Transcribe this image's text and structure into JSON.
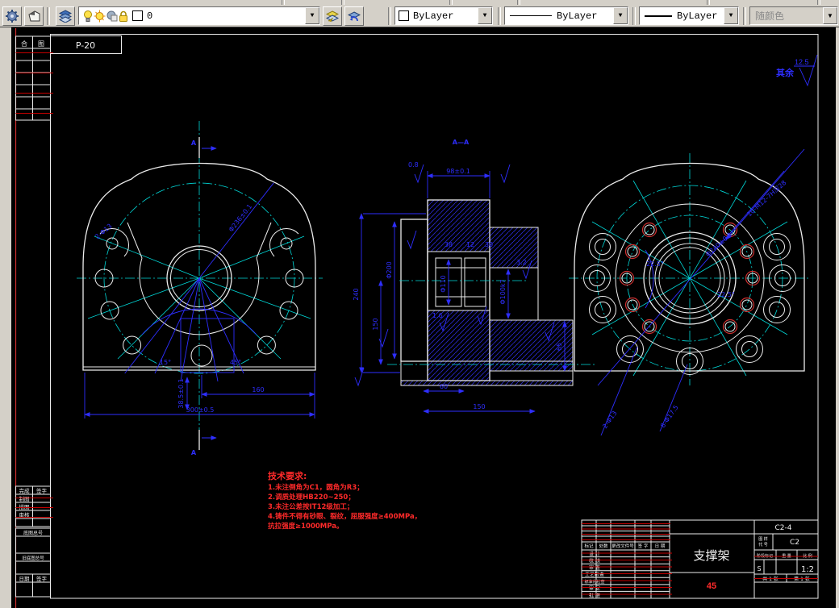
{
  "toolbar": {
    "layer_name": "0",
    "color": "ByLayer",
    "linetype": "ByLayer",
    "lineweight": "ByLayer",
    "plot_style": "随颜色"
  },
  "sheet": {
    "p20": "P-20",
    "surface_note": "其余",
    "roughness": "12.5",
    "section_letter": "A"
  },
  "left_top": {
    "h1": "合",
    "h2": "图"
  },
  "left_bottom": {
    "c1": "完成",
    "c2": "签字",
    "r1": "制图",
    "r2": "描图",
    "r3": "审核",
    "base_no": "底图总号",
    "old_no": "旧底图总号",
    "d1": "日期",
    "d2": "签字"
  },
  "front": {
    "bolt_circle": "Φ236±0.1",
    "lug_holes": "2-Φ13",
    "width": "300±0.5",
    "offset": "160",
    "height": "38.5±0.1",
    "angle_a": "15°",
    "angle_b": "45°"
  },
  "section": {
    "title": "A—A",
    "top": "98±0.1",
    "rough_small": "0.8",
    "v_overall": "240",
    "v_inner": "150",
    "flange": "Φ200",
    "bore1": "Φ110",
    "bore2": "Φ100k7",
    "w1": "38",
    "w2": "12",
    "w3": "30",
    "base_w": "60",
    "total_w": "150",
    "right_h": "65",
    "r1": "1.6",
    "r2": "3.2"
  },
  "rear": {
    "thread_holes": "10-M12-7H深28",
    "bore_dia": "Φ240±0.1",
    "cb_holes": "8-Φ17.5",
    "pin_holes": "2-Φ13",
    "ang1": "22.5°"
  },
  "tech_req": {
    "title": "技术要求:",
    "lines": [
      "1.未注倒角为C1，圆角为R3；",
      "2.调质处理HB220~250；",
      "3.未注公差按IT12级加工；",
      "4.铸件不得有砂眼、裂纹，屈服强度≥400MPa，",
      "抗拉强度≥1000MPa。"
    ]
  },
  "title_block": {
    "rev_header": [
      "标记",
      "处数",
      "更改文件号",
      "签 字",
      "日 期"
    ],
    "rows": [
      "设 计",
      "校 核",
      "审 查",
      "工艺检查",
      "标准化检查",
      "审 定",
      "批 准"
    ],
    "part_name": "支撑架",
    "material": "45",
    "drawing_no": "C2-4",
    "code_label_l1": "图 样",
    "code_label_l2": "代 号",
    "code_value": "C2",
    "stage_header": [
      "阶段标记",
      "重 量",
      "比 例"
    ],
    "stage_mark": "S",
    "scale": "1:2",
    "sheet_total": "共 1 张",
    "sheet_no": "第 1 张"
  }
}
